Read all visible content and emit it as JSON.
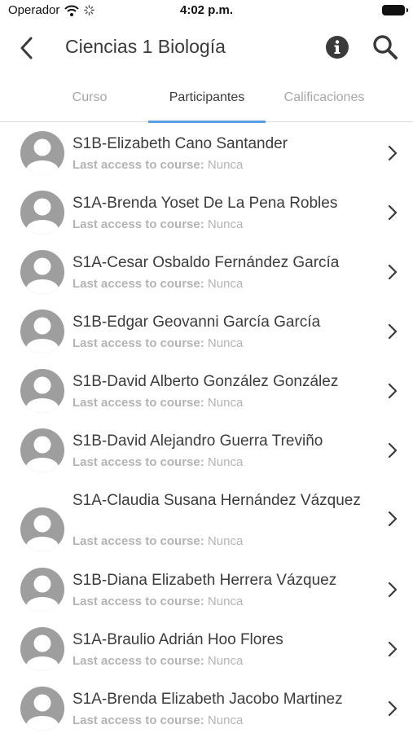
{
  "status_bar": {
    "carrier": "Operador",
    "time": "4:02 p.m."
  },
  "header": {
    "title": "Ciencias 1 Biología"
  },
  "tabs": [
    {
      "label": "Curso",
      "active": false
    },
    {
      "label": "Participantes",
      "active": true
    },
    {
      "label": "Calificaciones",
      "active": false
    }
  ],
  "participants": [
    {
      "name": "S1B-Elizabeth Cano Santander",
      "access_label": "Last access to course:",
      "access_value": "Nunca"
    },
    {
      "name": "S1A-Brenda Yoset De La Pena Robles",
      "access_label": "Last access to course:",
      "access_value": "Nunca"
    },
    {
      "name": "S1A-Cesar Osbaldo Fernández García",
      "access_label": "Last access to course:",
      "access_value": "Nunca"
    },
    {
      "name": "S1B-Edgar Geovanni García García",
      "access_label": "Last access to course:",
      "access_value": "Nunca"
    },
    {
      "name": "S1B-David Alberto González González",
      "access_label": "Last access to course:",
      "access_value": "Nunca"
    },
    {
      "name": "S1B-David Alejandro Guerra Treviño",
      "access_label": "Last access to course:",
      "access_value": "Nunca"
    },
    {
      "name": "S1A-Claudia Susana Hernández Vázquez",
      "access_label": "Last access to course:",
      "access_value": "Nunca"
    },
    {
      "name": "S1B-Diana Elizabeth Herrera Vázquez",
      "access_label": "Last access to course:",
      "access_value": "Nunca"
    },
    {
      "name": "S1A-Braulio Adrián Hoo Flores",
      "access_label": "Last access to course:",
      "access_value": "Nunca"
    },
    {
      "name": "S1A-Brenda Elizabeth Jacobo Martinez",
      "access_label": "Last access to course:",
      "access_value": "Nunca"
    }
  ],
  "colors": {
    "accent": "#5b9fe0",
    "icon": "#3a3a3a",
    "avatar": "#9e9e9e",
    "muted_text": "#b4b4b4"
  },
  "icons": {
    "back": "chevron-left-icon",
    "info": "info-icon",
    "search": "search-icon",
    "row_chevron": "chevron-right-icon",
    "avatar": "user-avatar-icon"
  }
}
